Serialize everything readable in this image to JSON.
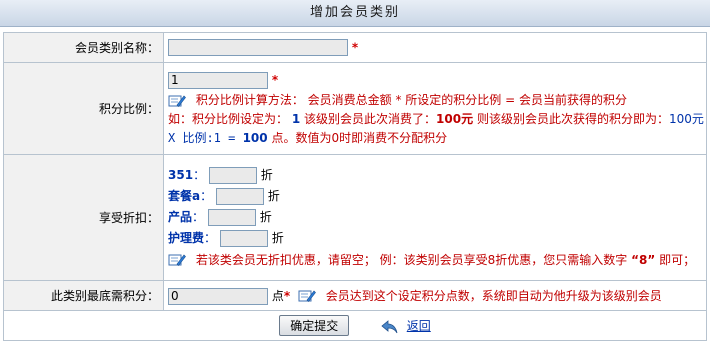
{
  "title": "增加会员类别",
  "name_row": {
    "label": "会员类别名称：",
    "value": "",
    "required": "*"
  },
  "points_row": {
    "label": "积分比例：",
    "value": "1",
    "required": "*",
    "method_text": "积分比例计算方法： 会员消费总金额 * 所设定的积分比例 = 会员当前获得的积分",
    "example_p1": "如：积分比例设定为：",
    "example_ratio": "1",
    "example_p2": "该级别会员此次消费了：",
    "example_amount": "100元",
    "example_p3": "则该级别会员此次获得的积分即为：",
    "example_result": "100元",
    "formula_p1": "X 比例:1 = ",
    "formula_val": "100",
    "formula_p2": "点。数值为0时即消费不分配积分"
  },
  "discount_row": {
    "label": "享受折扣：",
    "items": [
      {
        "name": "351",
        "sep": "：",
        "value": "",
        "unit": "折"
      },
      {
        "name": "套餐a",
        "sep": "：",
        "value": "",
        "unit": "折"
      },
      {
        "name": "产品",
        "sep": "：",
        "value": "",
        "unit": "折"
      },
      {
        "name": "护理费",
        "sep": "：",
        "value": "",
        "unit": "折"
      }
    ],
    "hint_p1": "若该类会员无折扣优惠，请留空；  例：该类别会员享受8折优惠，您只需输入数字",
    "hint_num": "“8”",
    "hint_p2": "即可；"
  },
  "min_points_row": {
    "label": "此类别最底需积分：",
    "value": "0",
    "unit": "点",
    "required": "*",
    "hint": "会员达到这个设定积分点数，系统即自动为他升级为该级别会员"
  },
  "actions": {
    "submit_label": "确定提交",
    "back_label": "返回"
  },
  "colors": {
    "accent_red": "#c00000",
    "accent_blue": "#0033aa",
    "label_bg": "#f1f1f1",
    "border": "#b7c3cf"
  }
}
